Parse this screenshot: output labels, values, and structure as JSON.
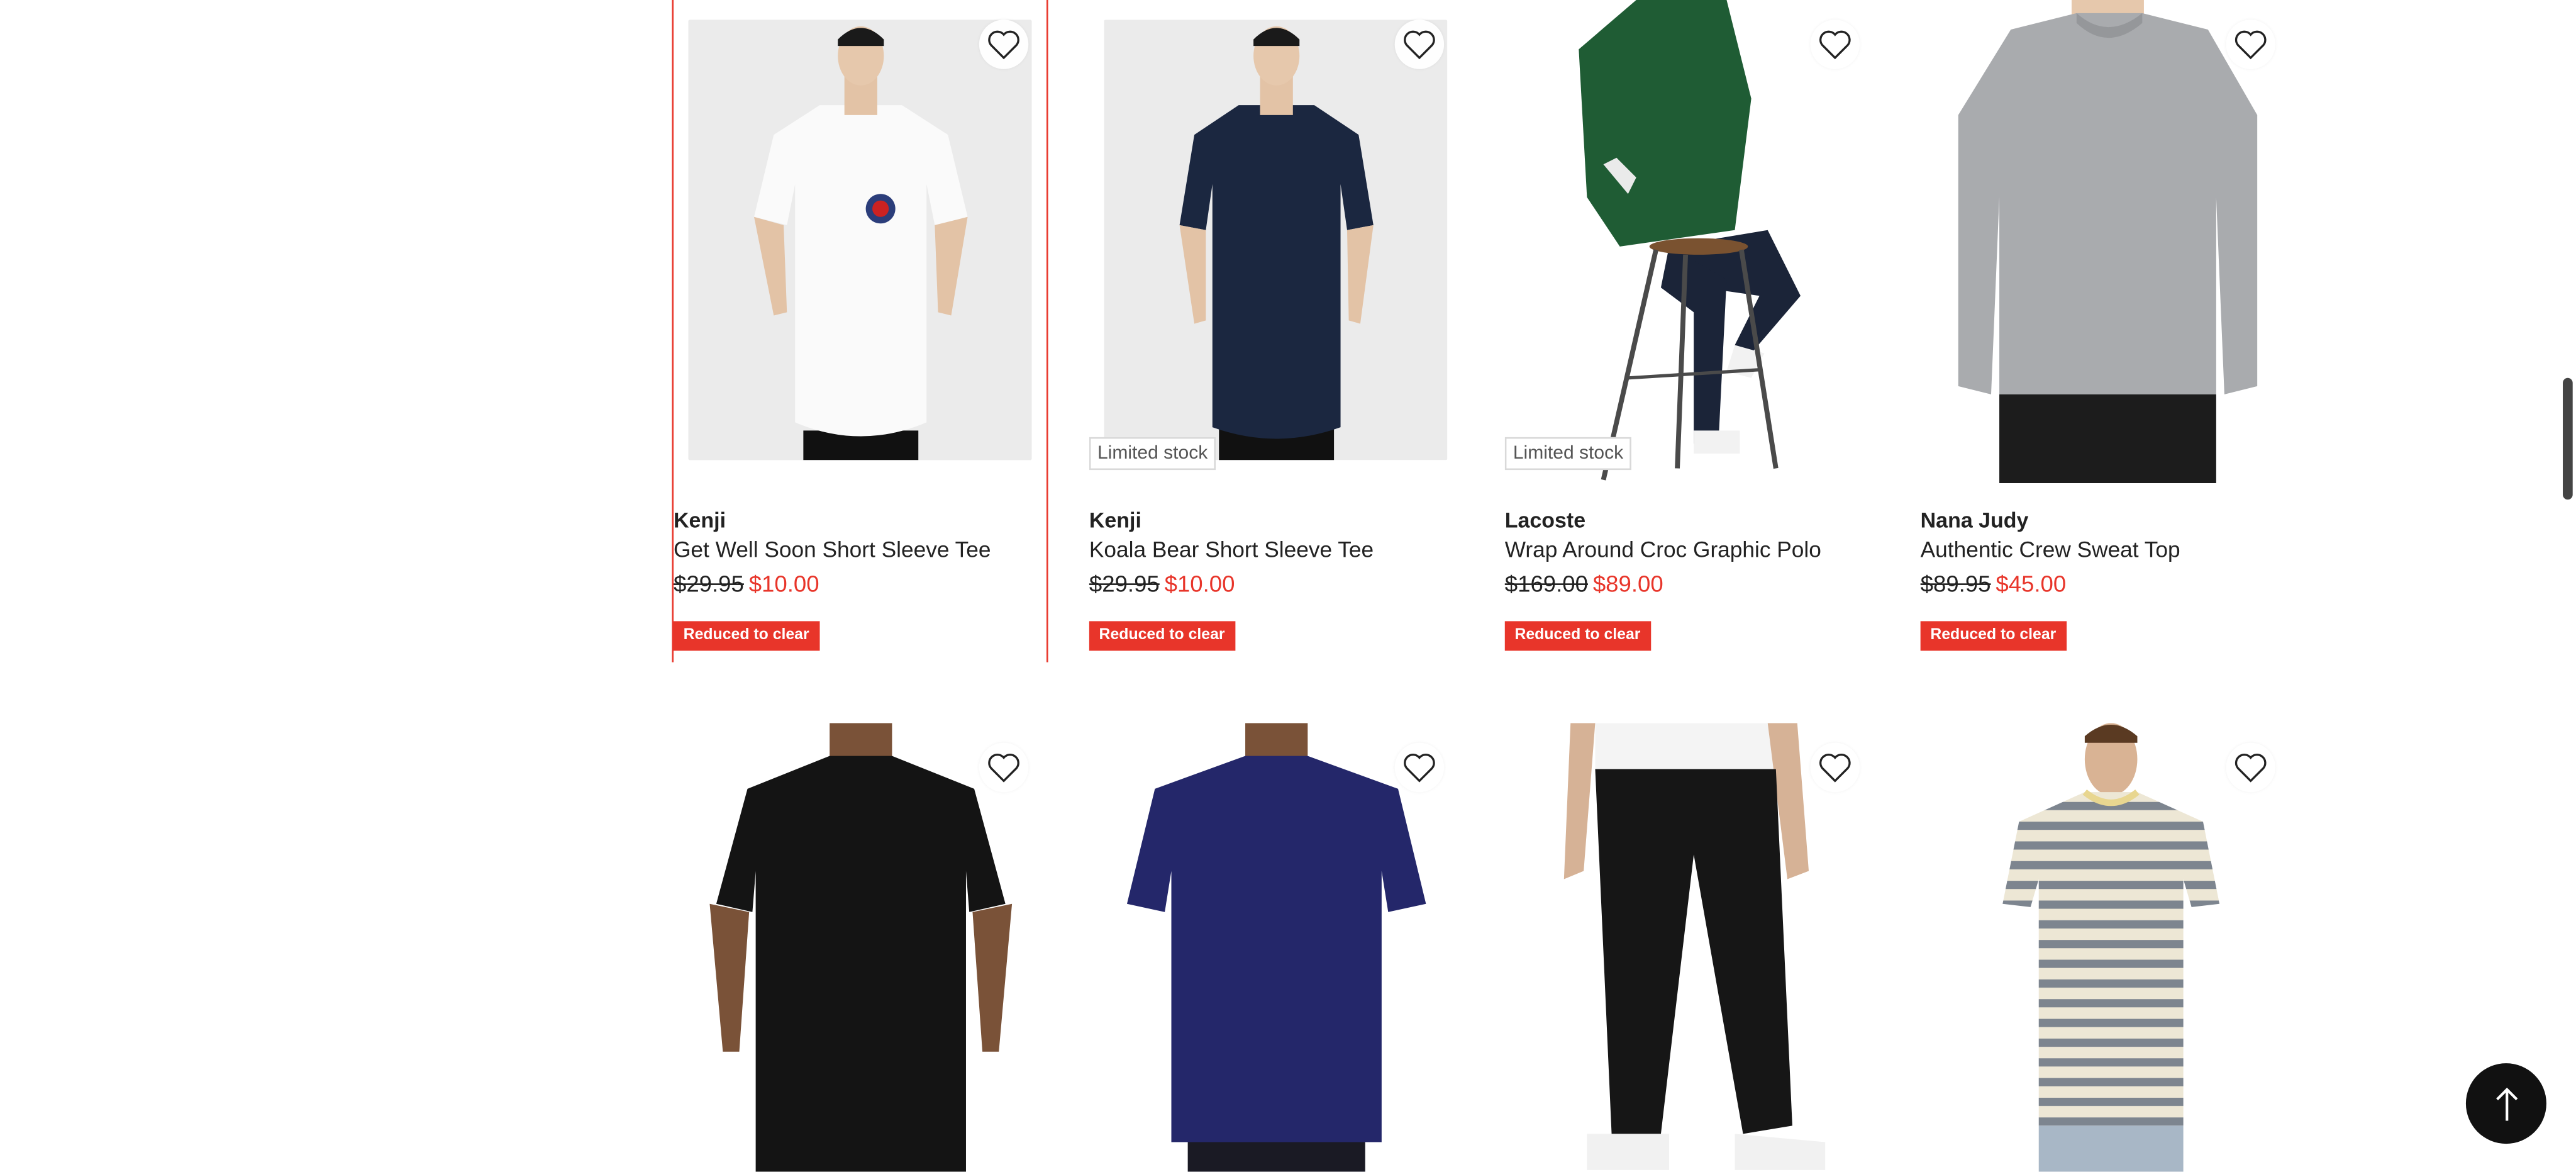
{
  "products": [
    {
      "brand": "Kenji",
      "title": "Get Well Soon Short Sleeve Tee",
      "price_original": "$29.95",
      "price_sale": "$10.00",
      "badge": "Reduced to clear",
      "stock": ""
    },
    {
      "brand": "Kenji",
      "title": "Koala Bear Short Sleeve Tee",
      "price_original": "$29.95",
      "price_sale": "$10.00",
      "badge": "Reduced to clear",
      "stock": "Limited stock"
    },
    {
      "brand": "Lacoste",
      "title": "Wrap Around Croc Graphic Polo",
      "price_original": "$169.00",
      "price_sale": "$89.00",
      "badge": "Reduced to clear",
      "stock": "Limited stock"
    },
    {
      "brand": "Nana Judy",
      "title": "Authentic Crew Sweat Top",
      "price_original": "$89.95",
      "price_sale": "$45.00",
      "badge": "Reduced to clear",
      "stock": ""
    }
  ],
  "colors": {
    "accent": "#e8352a",
    "text": "#222222",
    "back_to_top_bg": "#111111"
  },
  "icons": {
    "favorite": "heart-outline-icon",
    "back_to_top": "arrow-up-icon"
  }
}
